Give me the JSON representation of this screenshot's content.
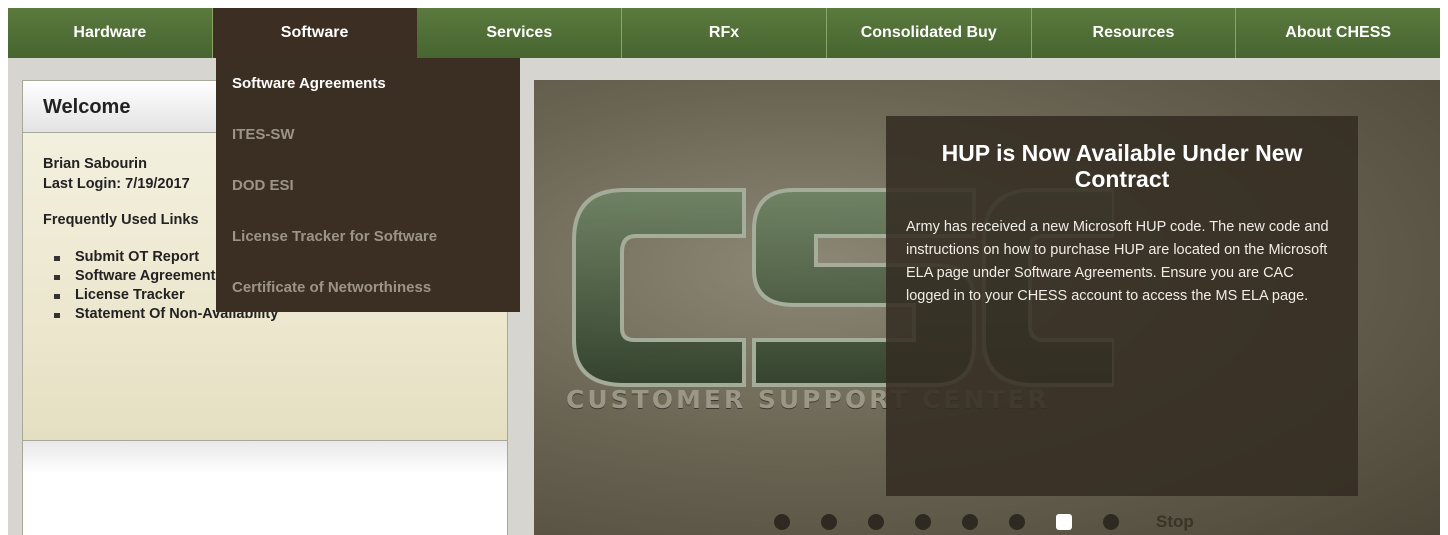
{
  "nav": {
    "items": [
      "Hardware",
      "Software",
      "Services",
      "RFx",
      "Consolidated Buy",
      "Resources",
      "About CHESS"
    ],
    "active": "Software"
  },
  "dropdown": {
    "items": [
      "Software Agreements",
      "ITES-SW",
      "DOD ESI",
      "License Tracker for Software",
      "Certificate of Networthiness"
    ]
  },
  "welcome": {
    "title": "Welcome",
    "user_name": "Brian Sabourin",
    "last_login": "Last Login: 7/19/2017",
    "links_heading": "Frequently Used Links",
    "links": [
      "Submit OT Report",
      "Software Agreements",
      "License Tracker",
      "Statement Of Non-Availability"
    ]
  },
  "slider": {
    "logo_tagline": "CUSTOMER SUPPORT CENTER",
    "news_title": "HUP is Now Available Under New Contract",
    "news_text": "Army has received a new Microsoft HUP code. The new code and instructions on how to purchase HUP are located on the Microsoft ELA page under Software Agreements. Ensure you are CAC logged in to your CHESS account to access the MS ELA page.",
    "slide_count": 8,
    "active_slide": 7,
    "stop_label": "Stop"
  },
  "colors": {
    "nav_green": "#4f6f35",
    "dropdown_brown": "#3b2e23",
    "news_box": "#342c22"
  }
}
